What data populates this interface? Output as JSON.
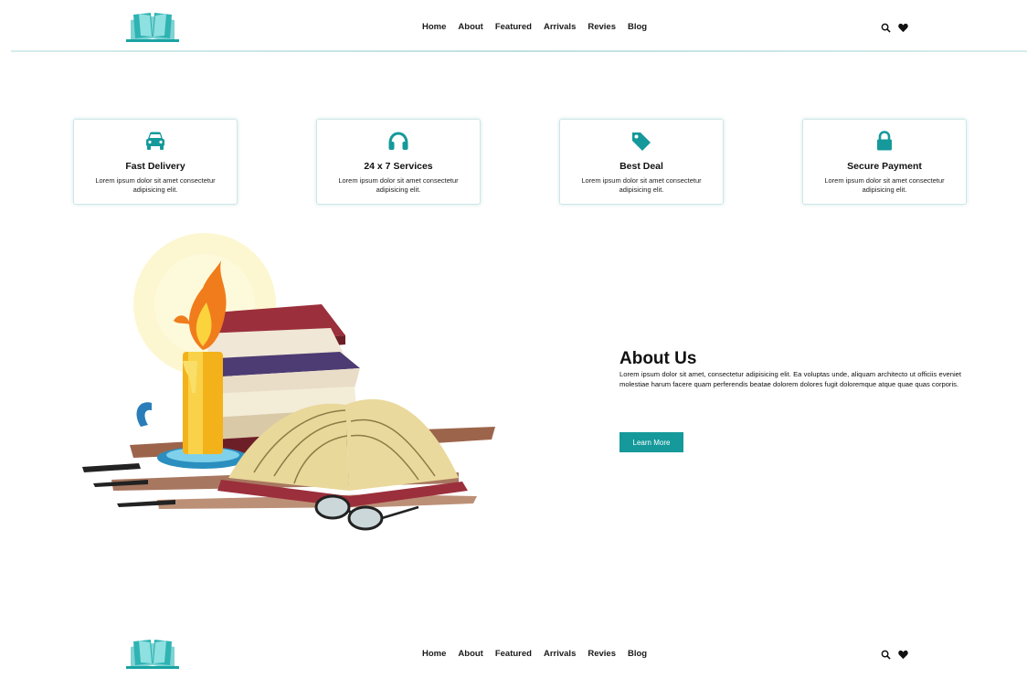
{
  "colors": {
    "accent": "#15999a",
    "text": "#111111",
    "border": "#cfe6e6"
  },
  "nav": {
    "links": [
      "Home",
      "About",
      "Featured",
      "Arrivals",
      "Revies",
      "Blog"
    ],
    "icons": [
      "search-icon",
      "heart-icon"
    ]
  },
  "features": [
    {
      "icon": "car-icon",
      "title": "Fast Delivery",
      "desc": "Lorem ipsum dolor sit amet consectetur adipisicing elit."
    },
    {
      "icon": "headphones-icon",
      "title": "24 x 7 Services",
      "desc": "Lorem ipsum dolor sit amet consectetur adipisicing elit."
    },
    {
      "icon": "tag-icon",
      "title": "Best Deal",
      "desc": "Lorem ipsum dolor sit amet consectetur adipisicing elit."
    },
    {
      "icon": "lock-icon",
      "title": "Secure Payment",
      "desc": "Lorem ipsum dolor sit amet consectetur adipisicing elit."
    }
  ],
  "about": {
    "title": "About Us",
    "text": "Lorem ipsum dolor sit amet, consectetur adipisicing elit. Ea voluptas unde, aliquam architecto ut officiis eveniet molestiae harum facere quam perferendis beatae dolorem dolores fugit doloremque atque quae quas corporis.",
    "button_label": "Learn More",
    "image": "books-candle-illustration"
  }
}
